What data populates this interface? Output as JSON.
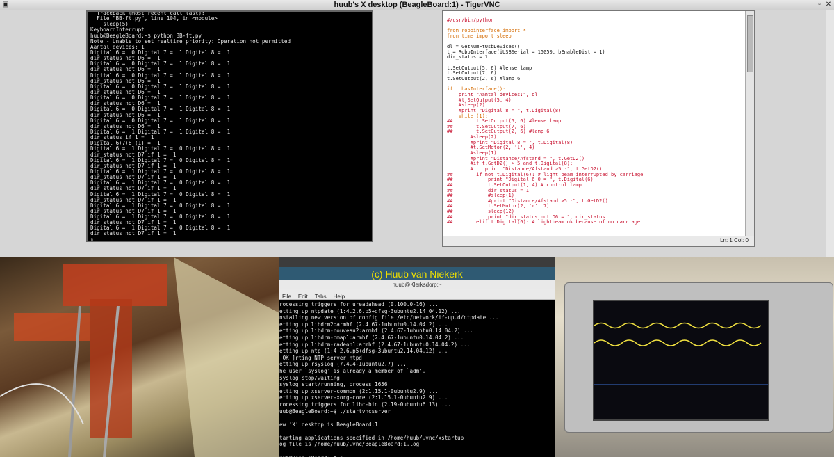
{
  "window": {
    "title": "huub's X desktop (BeagleBoard:1) - TigerVNC"
  },
  "terminal": {
    "lines": [
      "  Traceback (most recent call last):",
      "  File \"BB-ft.py\", line 104, in <module>",
      "    sleep(5)",
      "KeyboardInterrupt",
      "huub@BeagleBoard:~$ python BB-ft.py",
      "Note - Unable to set realtime priority: Operation not permitted",
      "Aantal devices: 1",
      "Digital 6 =  0 Digital 7 =  1 Digital 8 =  1",
      "dir_status not D6 =  1",
      "Digital 6 =  0 Digital 7 =  1 Digital 8 =  1",
      "dir_status not D6 =  1",
      "Digital 6 =  0 Digital 7 =  1 Digital 8 =  1",
      "dir_status not D6 =  1",
      "Digital 6 =  0 Digital 7 =  1 Digital 8 =  1",
      "dir_status not D6 =  1",
      "Digital 6 =  0 Digital 7 =  1 Digital 8 =  1",
      "dir_status not D6 =  1",
      "Digital 6 =  0 Digital 7 =  1 Digital 8 =  1",
      "dir_status not D6 =  1",
      "Digital 6 =  0 Digital 7 =  1 Digital 8 =  1",
      "dir_status not D6 =  1",
      "Digital 6 =  1 Digital 7 =  1 Digital 8 =  1",
      "dir_status if 1 =  1",
      "Digital 6+7+8 (1) =  1",
      "Digital 6 =  1 Digital 7 =  0 Digital 8 =  1",
      "dir_status not D7 if 1 =  1",
      "Digital 6 =  1 Digital 7 =  0 Digital 8 =  1",
      "dir_status not D7 if 1 =  1",
      "Digital 6 =  1 Digital 7 =  0 Digital 8 =  1",
      "dir_status not D7 if 1 =  1",
      "Digital 6 =  1 Digital 7 =  0 Digital 8 =  1",
      "dir_status not D7 if 1 =  1",
      "Digital 6 =  1 Digital 7 =  0 Digital 8 =  1",
      "dir_status not D7 if 1 =  1",
      "Digital 6 =  1 Digital 7 =  0 Digital 8 =  1",
      "dir_status not D7 if 1 =  1",
      "Digital 6 =  1 Digital 7 =  0 Digital 8 =  1",
      "dir_status not D7 if 1 =  1",
      "Digital 6 =  1 Digital 7 =  0 Digital 8 =  1",
      "dir_status not D7 if 1 =  1",
      "▯"
    ]
  },
  "editor": {
    "lines": [
      {
        "t": "#/usr/bin/python",
        "c": "comment"
      },
      {
        "t": "",
        "c": "code"
      },
      {
        "t": "from robointerface import *",
        "c": "import"
      },
      {
        "t": "from time import sleep",
        "c": "import"
      },
      {
        "t": "",
        "c": "code"
      },
      {
        "t": "dl = GetNumFtUsbDevices()",
        "c": "code"
      },
      {
        "t": "t = RoboInterface(iUSBSerial = 15050, bEnableDist = 1)",
        "c": "code"
      },
      {
        "t": "dir_status = 1",
        "c": "code"
      },
      {
        "t": "",
        "c": "code"
      },
      {
        "t": "t.SetOutput(5, 6) #lense lamp",
        "c": "mixed"
      },
      {
        "t": "t.SetOutput(7, 6)",
        "c": "code"
      },
      {
        "t": "t.SetOutput(2, 6) #lamp 6",
        "c": "mixed"
      },
      {
        "t": "",
        "c": "code"
      },
      {
        "t": "if t.hasInterface():",
        "c": "kw"
      },
      {
        "t": "    print \"Aantal devices:\", dl",
        "c": "string"
      },
      {
        "t": "    #t.SetOutput(5, 4)",
        "c": "comment"
      },
      {
        "t": "    #sleep(2)",
        "c": "comment"
      },
      {
        "t": "    #print \"Digital 8 = \", t.Digital(8)",
        "c": "comment"
      },
      {
        "t": "    while (1):",
        "c": "kw"
      },
      {
        "t": "##        t.SetOutput(5, 6) #lense lamp",
        "c": "comment"
      },
      {
        "t": "##        t.SetOutput(7, 6)",
        "c": "comment"
      },
      {
        "t": "##        t.SetOutput(2, 6) #lamp 6",
        "c": "comment"
      },
      {
        "t": "        #sleep(2)",
        "c": "comment"
      },
      {
        "t": "        #print \"Digital 8 = \", t.Digital(8)",
        "c": "comment"
      },
      {
        "t": "        #t.SetMotor(2, 'l', 4)",
        "c": "comment"
      },
      {
        "t": "        #sleep(1)",
        "c": "comment"
      },
      {
        "t": "        #print \"Distance/Afstand = \", t.GetD2()",
        "c": "comment"
      },
      {
        "t": "        #if t.GetD2() > 5 and t.Digital(8):",
        "c": "comment"
      },
      {
        "t": "        #    print \"Distance/Afstand >5 :\", t.GetD2()",
        "c": "comment"
      },
      {
        "t": "##        if not t.Digital(6): # light beam interrupted by carriage",
        "c": "comment"
      },
      {
        "t": "##            print \"Digital 6 0 = \", t.Digital(6)",
        "c": "comment"
      },
      {
        "t": "##            t.SetOutput(1, 4) # control lamp",
        "c": "comment"
      },
      {
        "t": "##            dir_status = 1",
        "c": "comment"
      },
      {
        "t": "##            #sleep(1)",
        "c": "comment"
      },
      {
        "t": "##            #print \"Distance/Afstand >5 :\", t.GetD2()",
        "c": "comment"
      },
      {
        "t": "##            t.SetMotor(2, 'r', 7)",
        "c": "comment"
      },
      {
        "t": "##            sleep(12)",
        "c": "comment"
      },
      {
        "t": "##            print \"dir_status not D6 = \", dir_status",
        "c": "comment"
      },
      {
        "t": "##        elif t.Digital(6): # lightbeam ok because of no carriage",
        "c": "comment"
      }
    ],
    "status": "Ln: 1 Col: 0"
  },
  "remote": {
    "banner": "(c) Huub van Niekerk",
    "xterm_title": "huub@Klerksdorp:~",
    "menu": [
      "File",
      "Edit",
      "Tabs",
      "Help"
    ],
    "lines": [
      "rocessing triggers for ureadahead (0.100.0-16) ...",
      "etting up ntpdate (1:4.2.6.p5+dfsg-3ubuntu2.14.04.12) ...",
      "nstalling new version of config file /etc/network/if-up.d/ntpdate ...",
      "etting up libdrm2:armhf (2.4.67-1ubuntu0.14.04.2) ...",
      "etting up libdrm-nouveau2:armhf (2.4.67-1ubuntu0.14.04.2) ...",
      "etting up libdrm-omap1:armhf (2.4.67-1ubuntu0.14.04.2) ...",
      "etting up libdrm-radeon1:armhf (2.4.67-1ubuntu0.14.04.2) ...",
      "etting up ntp (1:4.2.6.p5+dfsg-3ubuntu2.14.04.12) ...",
      " OK ]rting NTP server ntpd",
      "etting up rsyslog (7.4.4-1ubuntu2.7) ...",
      "he user `syslog' is already a member of `adm'.",
      "syslog stop/waiting",
      "syslog start/running, process 1656",
      "etting up xserver-common (2:1.15.1-0ubuntu2.9) ...",
      "etting up xserver-xorg-core (2:1.15.1-0ubuntu2.9) ...",
      "rocessing triggers for libc-bin (2.19-0ubuntu6.13) ...",
      "uub@BeagleBoard:~$ ./startvncserver",
      "",
      "ew 'X' desktop is BeagleBoard:1",
      "",
      "tarting applications specified in /home/huub/.vnc/xstartup",
      "og file is /home/huub/.vnc/BeagleBoard:1.log",
      "",
      "uub@BeagleBoard:~$ ▯"
    ]
  },
  "colors": {
    "comment": "#c8102e",
    "import": "#d46a00",
    "kw": "#d46a00",
    "string": "#b8001e",
    "code": "#111111",
    "banner": "#f0e000"
  }
}
